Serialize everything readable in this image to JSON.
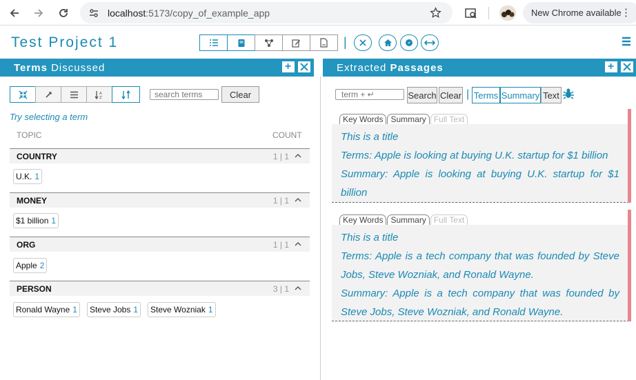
{
  "browser": {
    "url_host": "localhost",
    "url_path": ":5173/copy_of_example_app",
    "new_chrome_label": "New Chrome available",
    "icons": [
      "back-arrow-icon",
      "forward-arrow-icon",
      "reload-icon",
      "star-icon",
      "tab-search-icon",
      "profile-icon",
      "more-icon"
    ]
  },
  "header": {
    "project_title": "Test Project 1",
    "accent_color": "#1a8ab4"
  },
  "terms_panel": {
    "title_bold": "Terms",
    "title_rest": "Discussed",
    "search_placeholder": "search terms",
    "clear_label": "Clear",
    "hint": "Try selecting a term",
    "col_topic": "TOPIC",
    "col_count": "COUNT",
    "topics": [
      {
        "name": "COUNTRY",
        "count": "1 | 1",
        "terms": [
          {
            "label": "U.K.",
            "count": "1"
          }
        ]
      },
      {
        "name": "MONEY",
        "count": "1 | 1",
        "terms": [
          {
            "label": "$1 billion",
            "count": "1"
          }
        ]
      },
      {
        "name": "ORG",
        "count": "1 | 1",
        "terms": [
          {
            "label": "Apple",
            "count": "2"
          }
        ]
      },
      {
        "name": "PERSON",
        "count": "3 | 1",
        "terms": [
          {
            "label": "Ronald Wayne",
            "count": "1"
          },
          {
            "label": "Steve Jobs",
            "count": "1"
          },
          {
            "label": "Steve Wozniak",
            "count": "1"
          }
        ]
      }
    ]
  },
  "passages_panel": {
    "title_rest": "Extracted",
    "title_bold": "Passages",
    "term_placeholder": "term + ↵",
    "search_label": "Search",
    "clear_label": "Clear",
    "view_tabs": [
      "Terms",
      "Summary",
      "Text"
    ],
    "passage_tabs": [
      "Key Words",
      "Summary",
      "Full Text"
    ],
    "passages": [
      {
        "title": "This is a title",
        "terms": "Terms: Apple is looking at buying U.K. startup for $1 billion",
        "summary_1": "Summary: Apple is looking at buying U.K. startup for $1",
        "summary_2": "billion"
      },
      {
        "title": "This is a title",
        "terms_1": "Terms: Apple is a tech company that was founded by Steve",
        "terms_2": "Jobs, Steve Wozniak, and Ronald Wayne.",
        "summary_1": "Summary: Apple is a tech company that was founded by",
        "summary_2": "Steve Jobs, Steve Wozniak, and Ronald Wayne."
      }
    ],
    "highlight_color": "#e8868e"
  }
}
